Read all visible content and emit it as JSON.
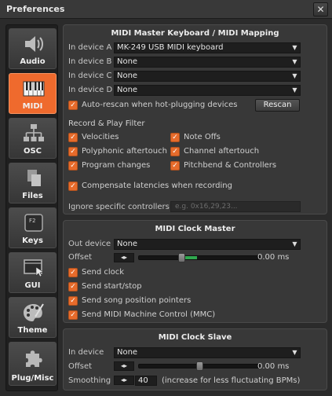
{
  "window": {
    "title": "Preferences",
    "close": "✕"
  },
  "sidebar": {
    "items": [
      {
        "label": "Audio",
        "icon": "speaker-icon"
      },
      {
        "label": "MIDI",
        "icon": "piano-keys-icon",
        "active": true
      },
      {
        "label": "OSC",
        "icon": "network-icon"
      },
      {
        "label": "Files",
        "icon": "files-icon"
      },
      {
        "label": "Keys",
        "icon": "keyboard-key-icon",
        "key_glyph": "F2"
      },
      {
        "label": "GUI",
        "icon": "window-cursor-icon"
      },
      {
        "label": "Theme",
        "icon": "palette-icon"
      },
      {
        "label": "Plug/Misc",
        "icon": "puzzle-icon"
      }
    ]
  },
  "midi_mapping": {
    "title": "MIDI Master Keyboard / MIDI Mapping",
    "devices": [
      {
        "label": "In device A",
        "value": "MK-249 USB MIDI keyboard"
      },
      {
        "label": "In device B",
        "value": "None"
      },
      {
        "label": "In device C",
        "value": "None"
      },
      {
        "label": "In device D",
        "value": "None"
      }
    ],
    "auto_rescan": {
      "label": "Auto-rescan when hot-plugging devices",
      "checked": true
    },
    "rescan_button": "Rescan",
    "filter_title": "Record & Play Filter",
    "filters": [
      {
        "label": "Velocities",
        "checked": true
      },
      {
        "label": "Note Offs",
        "checked": true
      },
      {
        "label": "Polyphonic aftertouch",
        "checked": true
      },
      {
        "label": "Channel aftertouch",
        "checked": true
      },
      {
        "label": "Program changes",
        "checked": true
      },
      {
        "label": "Pitchbend & Controllers",
        "checked": true
      }
    ],
    "compensate": {
      "label": "Compensate latencies when recording",
      "checked": true
    },
    "ignore_label": "Ignore specific controllers",
    "ignore_placeholder": "e.g. 0x16,29,23..."
  },
  "clock_master": {
    "title": "MIDI Clock Master",
    "out_label": "Out device",
    "out_value": "None",
    "offset_label": "Offset",
    "offset_spin": "◂▸",
    "offset_value": "0.00 ms",
    "offset_level": 0.35,
    "options": [
      {
        "label": "Send clock",
        "checked": true
      },
      {
        "label": "Send start/stop",
        "checked": true
      },
      {
        "label": "Send song position pointers",
        "checked": true
      },
      {
        "label": "Send MIDI Machine Control (MMC)",
        "checked": true
      }
    ]
  },
  "clock_slave": {
    "title": "MIDI Clock Slave",
    "in_label": "In device",
    "in_value": "None",
    "offset_label": "Offset",
    "offset_spin": "◂▸",
    "offset_value": "0.00 ms",
    "offset_level": 0.5,
    "smoothing_label": "Smoothing",
    "smoothing_spin": "◂▸",
    "smoothing_value": "40",
    "smoothing_hint": "(increase for less fluctuating BPMs)"
  },
  "colors": {
    "accent": "#ef6a2d",
    "panel": "#383838",
    "background": "#2b2b2b",
    "slider_fill": "#2fa84f"
  }
}
